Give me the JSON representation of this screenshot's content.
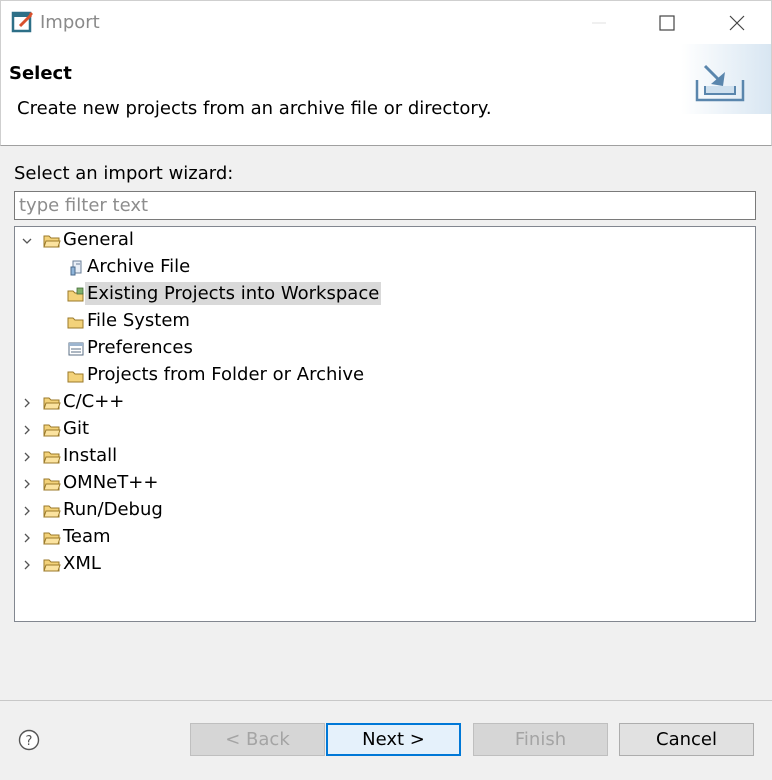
{
  "window": {
    "title": "Import",
    "icon": "eclipse-import-icon",
    "controls": [
      "minimize-icon",
      "maximize-icon",
      "close-icon"
    ]
  },
  "header": {
    "title": "Select",
    "description": "Create new projects from an archive file or directory."
  },
  "body": {
    "wizard_label": "Select an import wizard:",
    "filter_placeholder": "type filter text",
    "tree": [
      {
        "label": "General",
        "expanded": true,
        "icon": "folder-open-icon"
      },
      {
        "label": "Archive File",
        "icon": "archive-file-icon",
        "child": true
      },
      {
        "label": "Existing Projects into Workspace",
        "icon": "project-folder-icon",
        "child": true,
        "selected": true
      },
      {
        "label": "File System",
        "icon": "folder-icon",
        "child": true
      },
      {
        "label": "Preferences",
        "icon": "preferences-icon",
        "child": true
      },
      {
        "label": "Projects from Folder or Archive",
        "icon": "folder-icon",
        "child": true
      },
      {
        "label": "C/C++",
        "expanded": false,
        "icon": "folder-open-icon"
      },
      {
        "label": "Git",
        "expanded": false,
        "icon": "folder-open-icon"
      },
      {
        "label": "Install",
        "expanded": false,
        "icon": "folder-open-icon"
      },
      {
        "label": "OMNeT++",
        "expanded": false,
        "icon": "folder-open-icon"
      },
      {
        "label": "Run/Debug",
        "expanded": false,
        "icon": "folder-open-icon"
      },
      {
        "label": "Team",
        "expanded": false,
        "icon": "folder-open-icon"
      },
      {
        "label": "XML",
        "expanded": false,
        "icon": "folder-open-icon"
      }
    ]
  },
  "footer": {
    "back": "< Back",
    "next": "Next >",
    "finish": "Finish",
    "cancel": "Cancel",
    "help_icon": "help-icon"
  },
  "colors": {
    "selection": "#d9d9d9",
    "focus_border": "#0078d7",
    "folder": "#e8c45c"
  }
}
